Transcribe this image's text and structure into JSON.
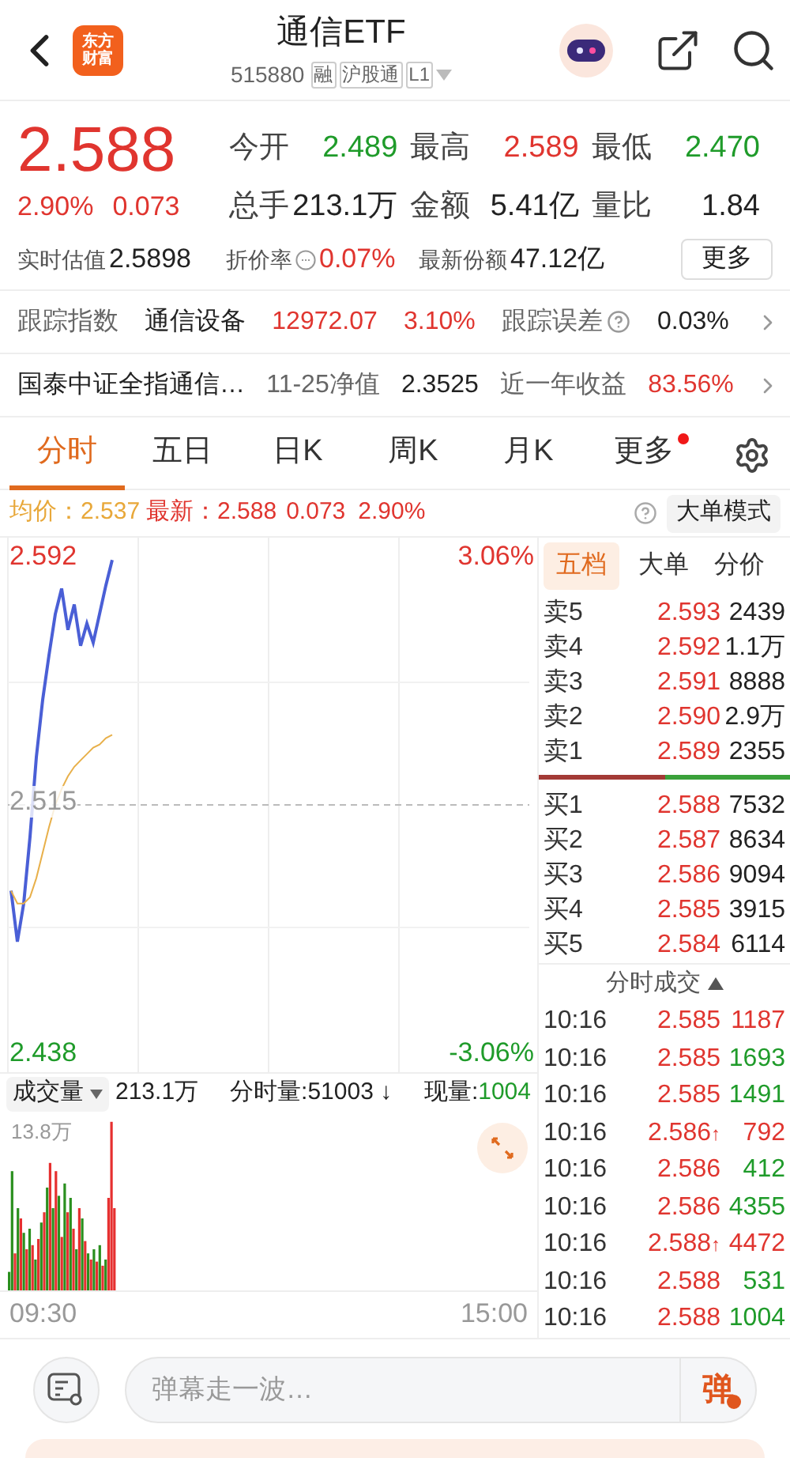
{
  "header": {
    "logo_text": [
      "东方",
      "财富"
    ],
    "title": "通信ETF",
    "code": "515880",
    "badges": [
      "融",
      "沪股通",
      "L1"
    ]
  },
  "quote": {
    "price": "2.588",
    "change_pct": "2.90%",
    "change": "0.073",
    "stats": [
      {
        "label": "今开",
        "value": "2.489",
        "color": "#1f9b2a"
      },
      {
        "label": "最高",
        "value": "2.589",
        "color": "#e0352f"
      },
      {
        "label": "最低",
        "value": "2.470",
        "color": "#1f9b2a"
      },
      {
        "label": "总手",
        "value": "213.1万",
        "color": "#222222"
      },
      {
        "label": "金额",
        "value": "5.41亿",
        "color": "#222222"
      },
      {
        "label": "量比",
        "value": "1.84",
        "color": "#222222"
      }
    ],
    "extras": [
      {
        "label": "实时估值",
        "value": "2.5898",
        "color": "#222222",
        "info": false
      },
      {
        "label": "折价率",
        "value": "0.07%",
        "color": "#e0352f",
        "info": true
      },
      {
        "label": "最新份额",
        "value": "47.12亿",
        "color": "#222222",
        "info": false
      }
    ],
    "more_button": "更多"
  },
  "info_rows": [
    {
      "cells": [
        {
          "text": "跟踪指数",
          "color": "#666666",
          "help": false
        },
        {
          "text": "通信设备",
          "color": "#222222",
          "help": false
        },
        {
          "text": "12972.07",
          "color": "#e0352f",
          "help": false
        },
        {
          "text": "3.10%",
          "color": "#e0352f",
          "help": false
        },
        {
          "text": "跟踪误差",
          "color": "#666666",
          "help": true
        },
        {
          "text": "0.03%",
          "color": "#222222",
          "help": false
        }
      ]
    },
    {
      "cells": [
        {
          "text": "国泰中证全指通信…",
          "color": "#222222",
          "help": false
        },
        {
          "text": "11-25净值",
          "color": "#666666",
          "help": false
        },
        {
          "text": "2.3525",
          "color": "#222222",
          "help": false
        },
        {
          "text": "近一年收益",
          "color": "#666666",
          "help": false
        },
        {
          "text": "83.56%",
          "color": "#e0352f",
          "help": false
        }
      ]
    }
  ],
  "tabs": [
    {
      "label": "分时",
      "selected": true,
      "kind": "plain"
    },
    {
      "label": "五日",
      "selected": false,
      "kind": "plain"
    },
    {
      "label": "日K",
      "selected": false,
      "kind": "plain"
    },
    {
      "label": "周K",
      "selected": false,
      "kind": "plain"
    },
    {
      "label": "月K",
      "selected": false,
      "kind": "plain"
    },
    {
      "label": "更多",
      "selected": false,
      "kind": "menu"
    }
  ],
  "summary": {
    "avg_label": "均价：",
    "avg": "2.537",
    "latest_label": "最新：",
    "latest": "2.588",
    "change": "0.073",
    "change_pct": "2.90%",
    "mode_button": "大单模式"
  },
  "price_chart": {
    "top_pct": "3.06%",
    "bottom_pct": "-3.06%",
    "price_labels": [
      "2.592",
      "2.515",
      "2.438"
    ]
  },
  "volume": {
    "selector": "成交量",
    "total": "213.1万",
    "period_label": "分时量:",
    "period": "51003",
    "period_arrow": "↓",
    "current_label": "现量:",
    "current": "1004",
    "max_label": "13.8万",
    "time_labels": [
      "09:30",
      "15:00"
    ]
  },
  "book": {
    "tabs": [
      {
        "label": "五档",
        "selected": true
      },
      {
        "label": "大单",
        "selected": false
      },
      {
        "label": "分价",
        "selected": false
      }
    ],
    "asks": [
      {
        "label": "卖5",
        "price": "2.593",
        "volume": "2439"
      },
      {
        "label": "卖4",
        "price": "2.592",
        "volume": "1.1万"
      },
      {
        "label": "卖3",
        "price": "2.591",
        "volume": "8888"
      },
      {
        "label": "卖2",
        "price": "2.590",
        "volume": "2.9万"
      },
      {
        "label": "卖1",
        "price": "2.589",
        "volume": "2355"
      }
    ],
    "balance": {
      "level": 0.5
    },
    "bids": [
      {
        "label": "买1",
        "price": "2.588",
        "volume": "7532"
      },
      {
        "label": "买2",
        "price": "2.587",
        "volume": "8634"
      },
      {
        "label": "买3",
        "price": "2.586",
        "volume": "9094"
      },
      {
        "label": "买4",
        "price": "2.585",
        "volume": "3915"
      },
      {
        "label": "买5",
        "price": "2.584",
        "volume": "6114"
      }
    ]
  },
  "trades": {
    "title": "分时成交",
    "expanded": false,
    "rows": [
      {
        "time": "10:16",
        "price": "2.585",
        "volume": "1187",
        "color": "#e0352f"
      },
      {
        "time": "10:16",
        "price": "2.585",
        "volume": "1693",
        "color": "#1f9b2a"
      },
      {
        "time": "10:16",
        "price": "2.585",
        "volume": "1491",
        "color": "#1f9b2a"
      },
      {
        "time": "10:16",
        "price": "2.586",
        "arrow": "↑",
        "volume": "792",
        "color": "#e0352f"
      },
      {
        "time": "10:16",
        "price": "2.586",
        "volume": "412",
        "color": "#1f9b2a"
      },
      {
        "time": "10:16",
        "price": "2.586",
        "volume": "4355",
        "color": "#1f9b2a"
      },
      {
        "time": "10:16",
        "price": "2.588",
        "arrow": "↑",
        "volume": "4472",
        "color": "#e0352f"
      },
      {
        "time": "10:16",
        "price": "2.588",
        "volume": "531",
        "color": "#1f9b2a"
      },
      {
        "time": "10:16",
        "price": "2.588",
        "volume": "1004",
        "color": "#1f9b2a"
      }
    ]
  },
  "comment_bar": {
    "placeholder": "弹幕走一波…",
    "send": "弹"
  }
}
